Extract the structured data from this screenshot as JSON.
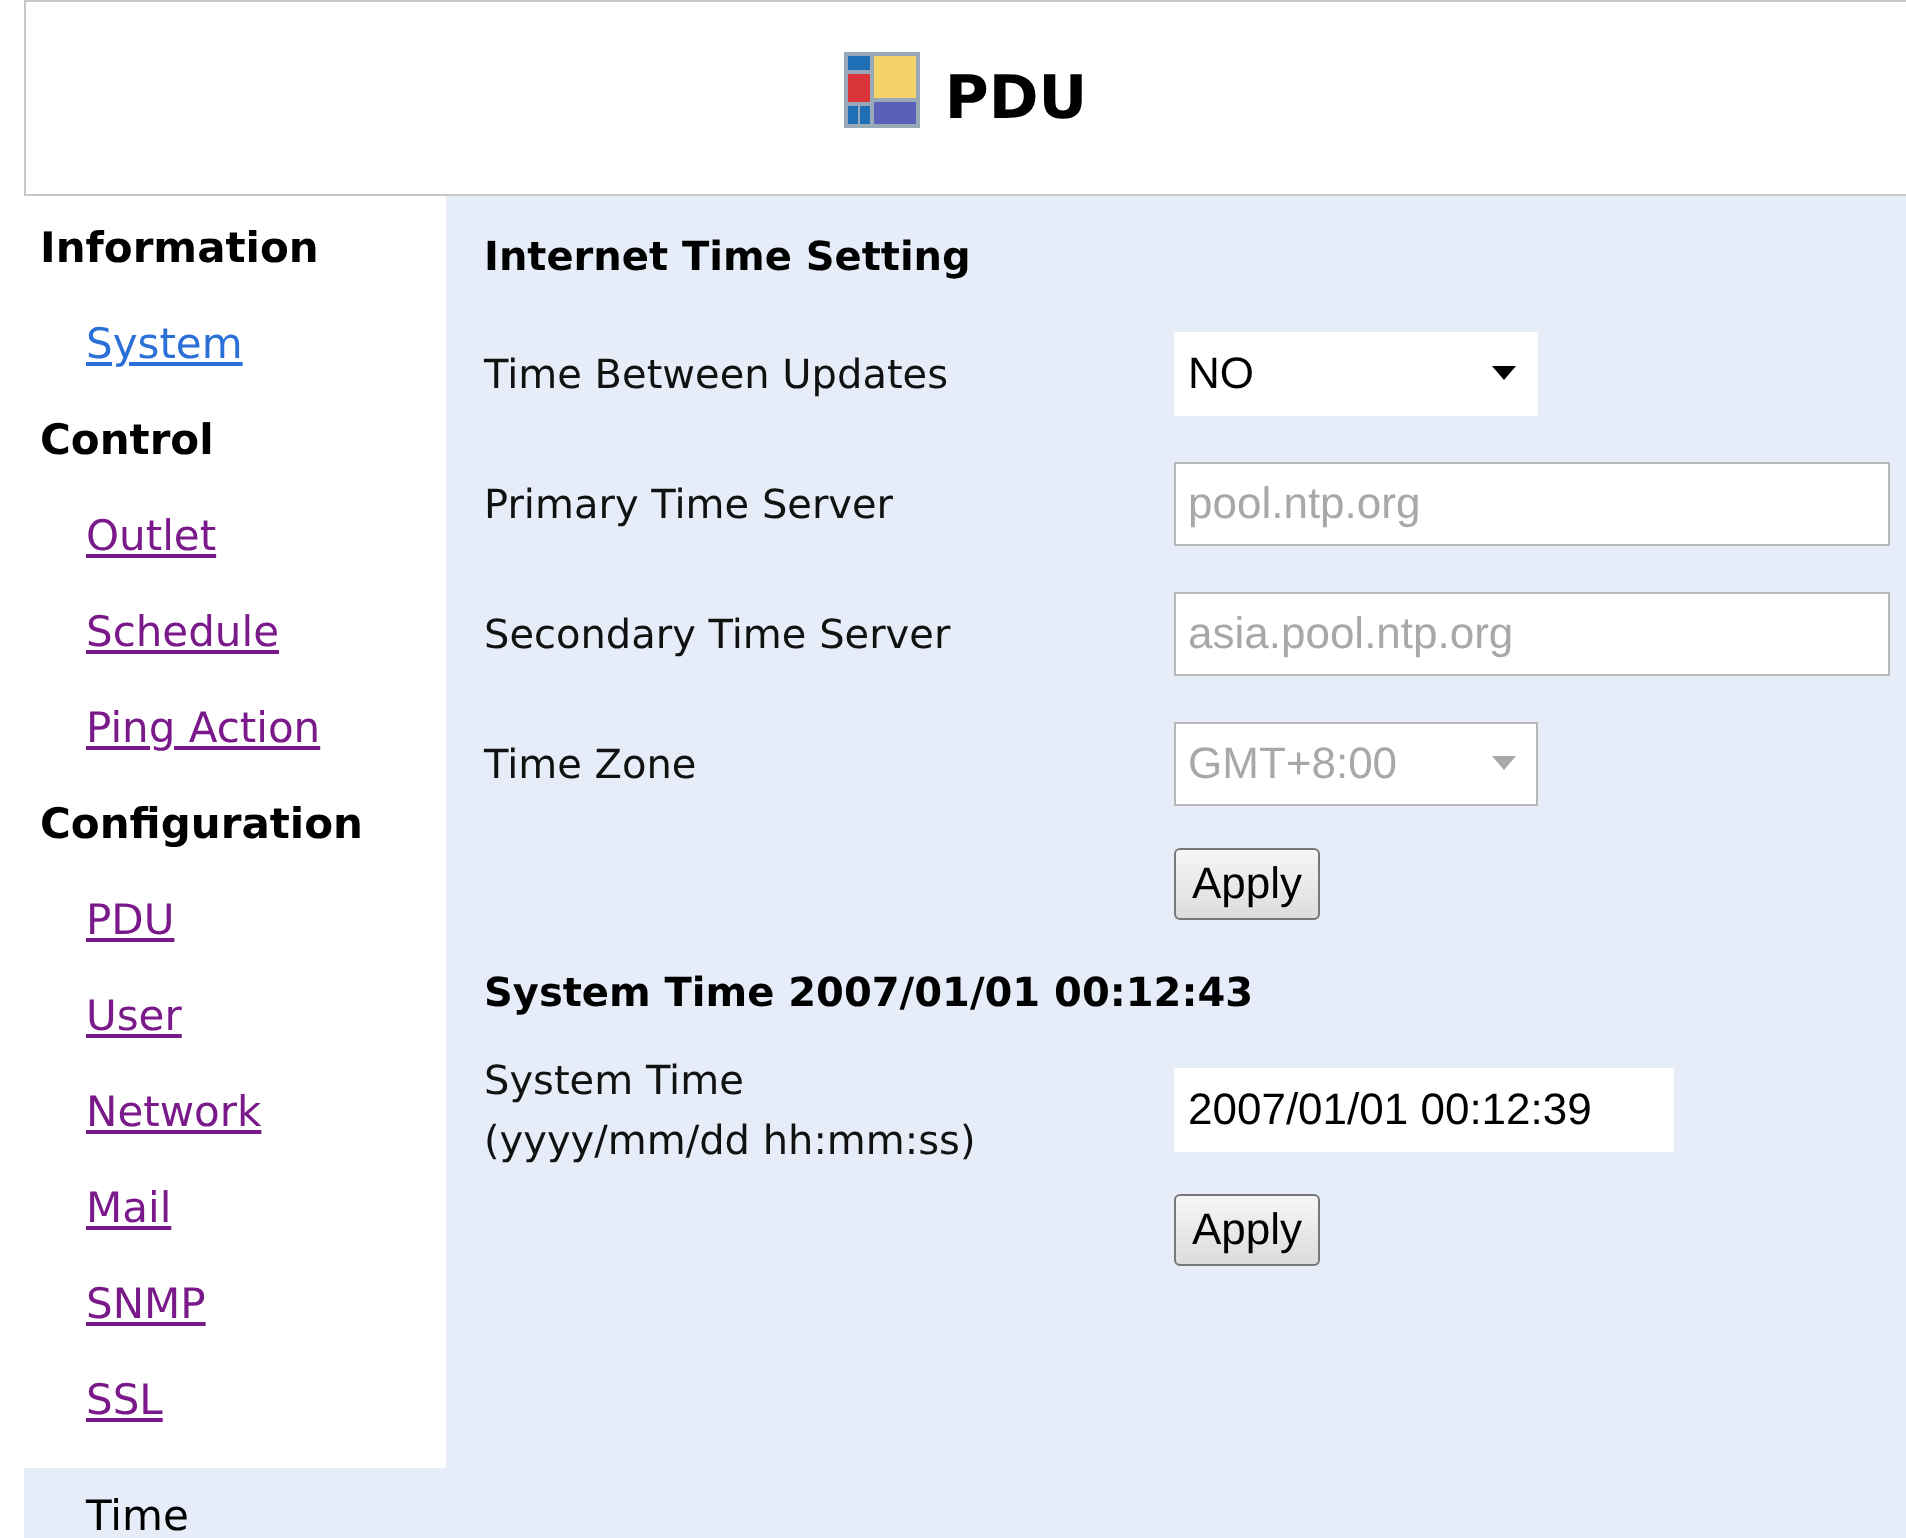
{
  "header": {
    "title": "PDU"
  },
  "sidebar": {
    "groups": [
      {
        "heading": "Information",
        "items": [
          {
            "label": "System",
            "visited": false,
            "selected": false
          }
        ]
      },
      {
        "heading": "Control",
        "items": [
          {
            "label": "Outlet",
            "visited": true,
            "selected": false
          },
          {
            "label": "Schedule",
            "visited": true,
            "selected": false
          },
          {
            "label": "Ping Action",
            "visited": true,
            "selected": false
          }
        ]
      },
      {
        "heading": "Configuration",
        "items": [
          {
            "label": "PDU",
            "visited": true,
            "selected": false
          },
          {
            "label": "User",
            "visited": true,
            "selected": false
          },
          {
            "label": "Network",
            "visited": true,
            "selected": false
          },
          {
            "label": "Mail",
            "visited": true,
            "selected": false
          },
          {
            "label": "SNMP",
            "visited": true,
            "selected": false
          },
          {
            "label": "SSL",
            "visited": true,
            "selected": false
          },
          {
            "label": "Time",
            "visited": false,
            "selected": true
          }
        ]
      }
    ]
  },
  "sections": [
    {
      "title": "Internet Time Setting",
      "rows": [
        {
          "kind": "select",
          "label": "Time Between Updates",
          "value": "NO",
          "disabled": false
        },
        {
          "kind": "text",
          "label": "Primary Time Server",
          "value": "pool.ntp.org",
          "disabled": true
        },
        {
          "kind": "text",
          "label": "Secondary Time Server",
          "value": "asia.pool.ntp.org",
          "disabled": true
        },
        {
          "kind": "select",
          "label": "Time Zone",
          "value": "GMT+8:00",
          "disabled": true
        }
      ],
      "button": "Apply"
    },
    {
      "title": "System Time 2007/01/01 00:12:43",
      "rows": [
        {
          "kind": "text",
          "label": "System Time (yyyy/mm/dd hh:mm:ss)",
          "value": "2007/01/01 00:12:39",
          "disabled": false
        }
      ],
      "button": "Apply"
    }
  ]
}
